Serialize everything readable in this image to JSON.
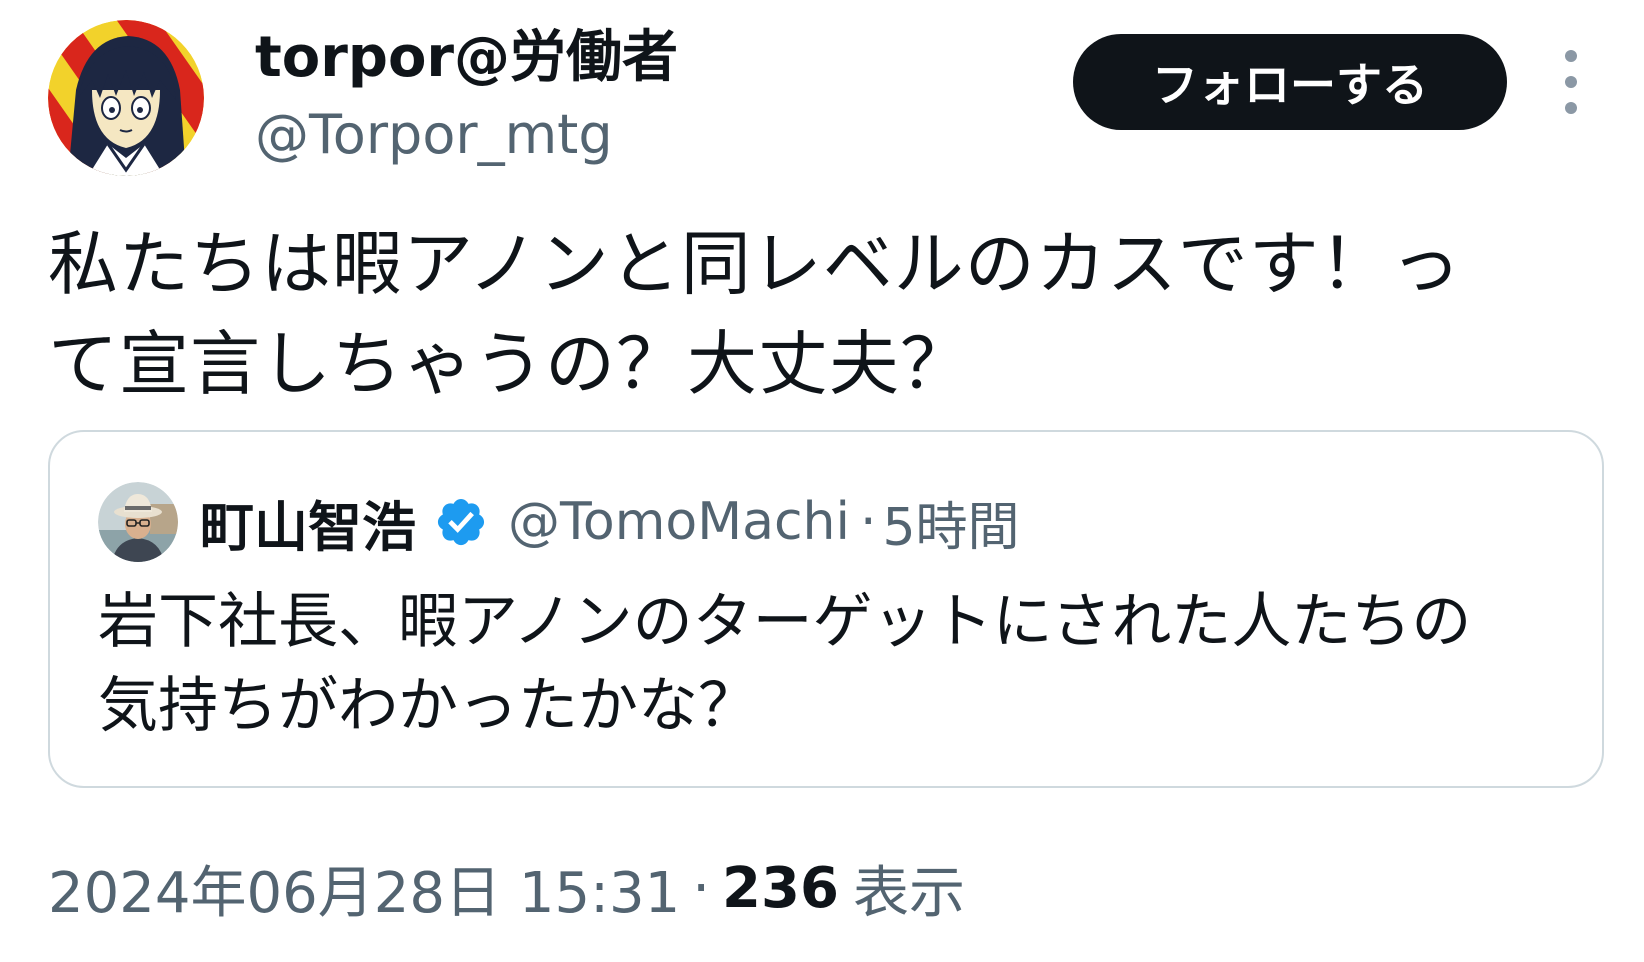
{
  "author": {
    "display_name": "torpor@労働者",
    "handle": "@Torpor_mtg",
    "avatar_icon": "anime-character-avatar"
  },
  "follow_button": {
    "label": "フォローする"
  },
  "more_button": {
    "icon": "more-vertical-icon"
  },
  "tweet": {
    "text": "私たちは暇アノンと同レベルのカスです！っ\nて宣言しちゃうの？大丈夫？"
  },
  "quoted_tweet": {
    "display_name": "町山智浩",
    "verified": true,
    "verified_icon": "verified-badge-icon",
    "handle": "@TomoMachi",
    "separator": "·",
    "time": "5時間",
    "text": "岩下社長、暇アノンのターゲットにされた人たちの\n気持ちがわかったかな？",
    "avatar_icon": "man-with-hat-avatar"
  },
  "meta": {
    "datetime": "2024年06月28日 15:31",
    "separator": "·",
    "views_count": "236",
    "views_label": "表示"
  },
  "colors": {
    "text_primary": "#0f1419",
    "text_secondary": "#536471",
    "follow_bg": "#0f1419",
    "border": "#cfd9de",
    "verified_blue": "#1d9bf0"
  }
}
